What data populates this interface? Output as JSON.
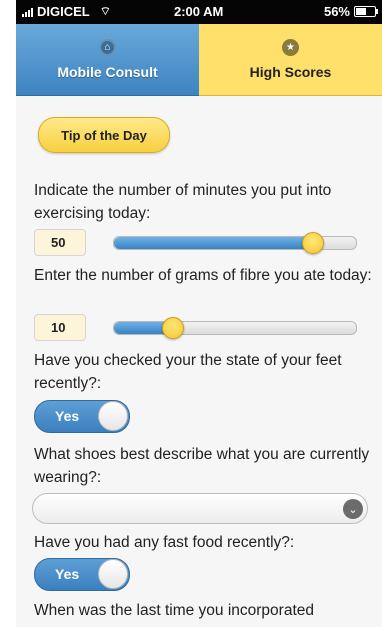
{
  "status_bar": {
    "carrier": "DIGICEL",
    "time": "2:00 AM",
    "battery": "56%",
    "battery_level": 0.56
  },
  "tabs": [
    {
      "label": "Mobile Consult",
      "icon": "home-icon",
      "active": false
    },
    {
      "label": "High Scores",
      "icon": "star-icon",
      "active": true
    }
  ],
  "tip_button": {
    "label": "Tip of the Day"
  },
  "questions": {
    "exercise": {
      "label": "Indicate the number of minutes you put into exercising today:",
      "value": "50",
      "slider_level": 0.82
    },
    "fibre": {
      "label": "Enter the number of grams of fibre you ate today:",
      "value": "10",
      "slider_level": 0.24
    },
    "feet": {
      "label": "Have you checked your the state of your feet recently?:",
      "toggle": "Yes"
    },
    "shoes": {
      "label": "What shoes best describe what you are currently wearing?:",
      "selected": ""
    },
    "fastfood": {
      "label": "Have you had any fast food recently?:",
      "toggle": "Yes"
    },
    "last": {
      "label": "When was the last time you incorporated"
    }
  },
  "colors": {
    "blue_tab": "#4f93cf",
    "yellow_tab": "#ffe06a",
    "slider_fill": "#3a83c2",
    "knob": "#f4c52c"
  }
}
